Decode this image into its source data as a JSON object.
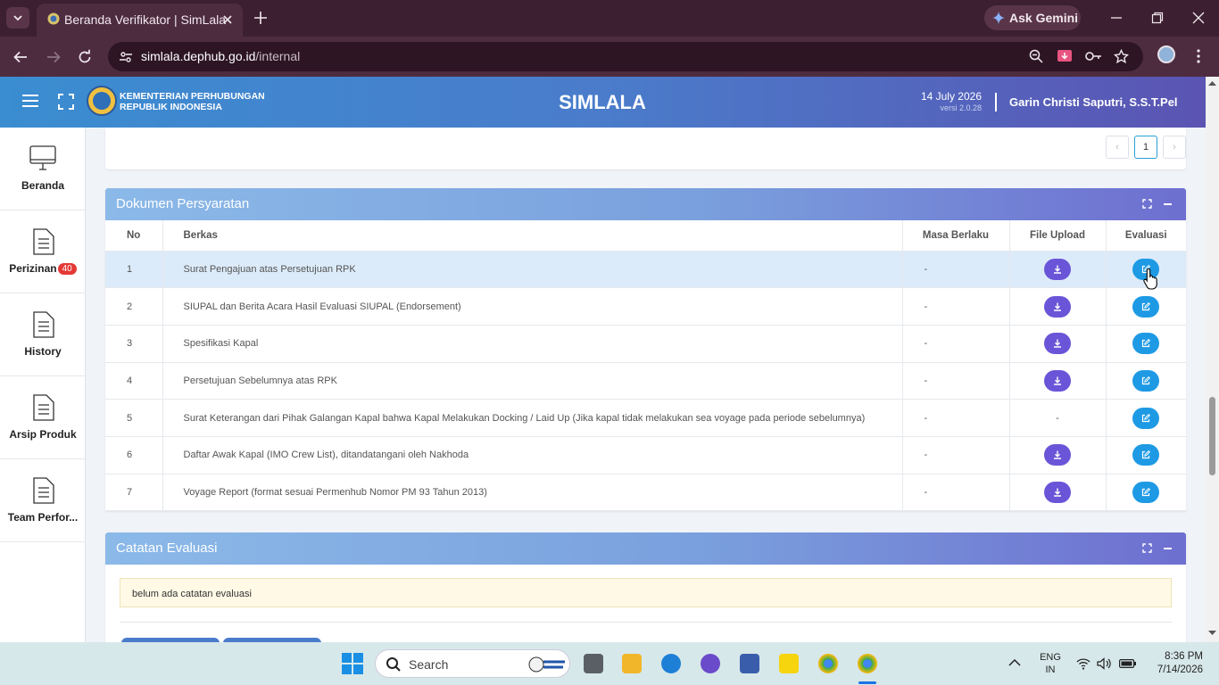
{
  "browser": {
    "tab_title": "Beranda Verifikator | SimLala",
    "ask_gemini": "Ask Gemini",
    "url_domain": "simlala.dephub.go.id",
    "url_path": "/internal"
  },
  "header": {
    "ministry_line1": "KEMENTERIAN PERHUBUNGAN",
    "ministry_line2": "REPUBLIK INDONESIA",
    "app_title": "SIMLALA",
    "date": "14 July 2026",
    "version": "versi 2.0.28",
    "user_name": "Garin Christi Saputri, S.S.T.Pel"
  },
  "sidebar": {
    "items": [
      {
        "label": "Beranda",
        "icon": "monitor-icon"
      },
      {
        "label": "Perizinan",
        "icon": "document-icon",
        "badge": "40"
      },
      {
        "label": "History",
        "icon": "document-icon"
      },
      {
        "label": "Arsip Produk",
        "icon": "document-icon"
      },
      {
        "label": "Team Perfor...",
        "icon": "document-icon"
      }
    ]
  },
  "pagination": {
    "prev": "‹",
    "current": "1",
    "next": "›"
  },
  "dokumen": {
    "title": "Dokumen Persyaratan",
    "columns": [
      "No",
      "Berkas",
      "Masa Berlaku",
      "File Upload",
      "Evaluasi"
    ],
    "rows": [
      {
        "no": "1",
        "berkas": "Surat Pengajuan atas Persetujuan RPK",
        "masa": "-",
        "upload": "download",
        "highlight": true
      },
      {
        "no": "2",
        "berkas": "SIUPAL dan Berita Acara Hasil Evaluasi SIUPAL (Endorsement)",
        "masa": "-",
        "upload": "download"
      },
      {
        "no": "3",
        "berkas": "Spesifikasi Kapal",
        "masa": "-",
        "upload": "download"
      },
      {
        "no": "4",
        "berkas": "Persetujuan Sebelumnya atas RPK",
        "masa": "-",
        "upload": "download"
      },
      {
        "no": "5",
        "berkas": "Surat Keterangan dari Pihak Galangan Kapal bahwa Kapal Melakukan Docking / Laid Up (Jika kapal tidak melakukan sea voyage pada periode sebelumnya)",
        "masa": "-",
        "upload": "-"
      },
      {
        "no": "6",
        "berkas": "Daftar Awak Kapal (IMO Crew List), ditandatangani oleh Nakhoda",
        "masa": "-",
        "upload": "download"
      },
      {
        "no": "7",
        "berkas": "Voyage Report (format sesuai Permenhub Nomor PM 93 Tahun 2013)",
        "masa": "-",
        "upload": "download"
      }
    ]
  },
  "catatan": {
    "title": "Catatan Evaluasi",
    "empty_text": "belum ada catatan evaluasi"
  },
  "taskbar": {
    "search_placeholder": "Search",
    "lang_line1": "ENG",
    "lang_line2": "IN",
    "time": "8:36 PM",
    "date": "7/14/2026"
  },
  "colors": {
    "header_start": "#3a8dd1",
    "header_end": "#5b54b3",
    "download_button": "#6a55d8",
    "evaluate_button": "#1e9ae5",
    "badge": "#e53935"
  }
}
